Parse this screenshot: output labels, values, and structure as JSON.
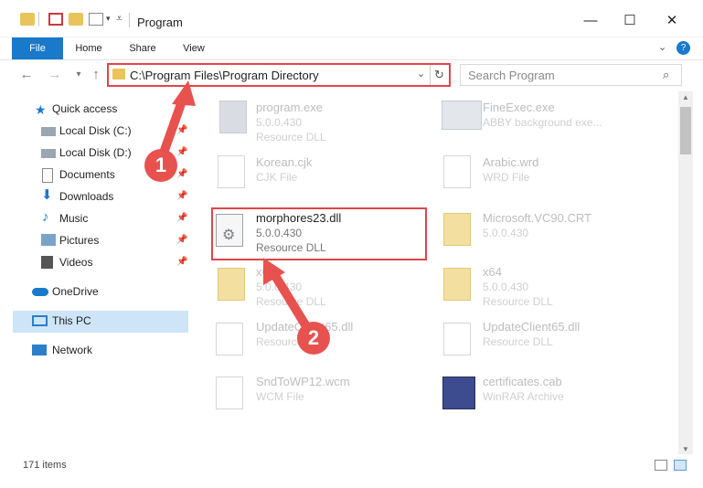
{
  "window": {
    "title": "Program"
  },
  "ribbon": {
    "tabs": [
      "File",
      "Home",
      "Share",
      "View"
    ]
  },
  "address": {
    "path": "C:\\Program Files\\Program Directory",
    "search_placeholder": "Search Program"
  },
  "nav": {
    "items": [
      {
        "label": "Quick access"
      },
      {
        "label": "Local Disk (C:)"
      },
      {
        "label": "Local Disk (D:)"
      },
      {
        "label": "Documents"
      },
      {
        "label": "Downloads"
      },
      {
        "label": "Music"
      },
      {
        "label": "Pictures"
      },
      {
        "label": "Videos"
      },
      {
        "label": "OneDrive"
      },
      {
        "label": "This PC"
      },
      {
        "label": "Network"
      }
    ]
  },
  "files": [
    {
      "name": "program.exe",
      "line2": "5.0.0.430",
      "line3": "Resource DLL"
    },
    {
      "name": "FineExec.exe",
      "line2": "ABBY background exe...",
      "line3": ""
    },
    {
      "name": "Korean.cjk",
      "line2": "CJK File",
      "line3": ""
    },
    {
      "name": "Arabic.wrd",
      "line2": "WRD File",
      "line3": ""
    },
    {
      "name": "morphores23.dll",
      "line2": "5.0.0.430",
      "line3": "Resource DLL"
    },
    {
      "name": "Microsoft.VC90.CRT",
      "line2": "5.0.0.430",
      "line3": ""
    },
    {
      "name": "x6",
      "line2": "5.0.0.430",
      "line3": "Resource DLL"
    },
    {
      "name": "x64",
      "line2": "5.0.0.430",
      "line3": "Resource DLL"
    },
    {
      "name": "UpdateClient65.dll",
      "line2": "Resource DLL",
      "line3": ""
    },
    {
      "name": "UpdateClient65.dll",
      "line2": "Resource DLL",
      "line3": ""
    },
    {
      "name": "SndToWP12.wcm",
      "line2": "WCM File",
      "line3": ""
    },
    {
      "name": "certificates.cab",
      "line2": "WinRAR Archive",
      "line3": ""
    }
  ],
  "status": {
    "items": "171 items"
  },
  "annotations": {
    "one": "1",
    "two": "2"
  },
  "colors": {
    "accent": "#1979ca",
    "highlight": "#e0454a",
    "badge": "#e8524e",
    "selected": "#cde5f7"
  }
}
